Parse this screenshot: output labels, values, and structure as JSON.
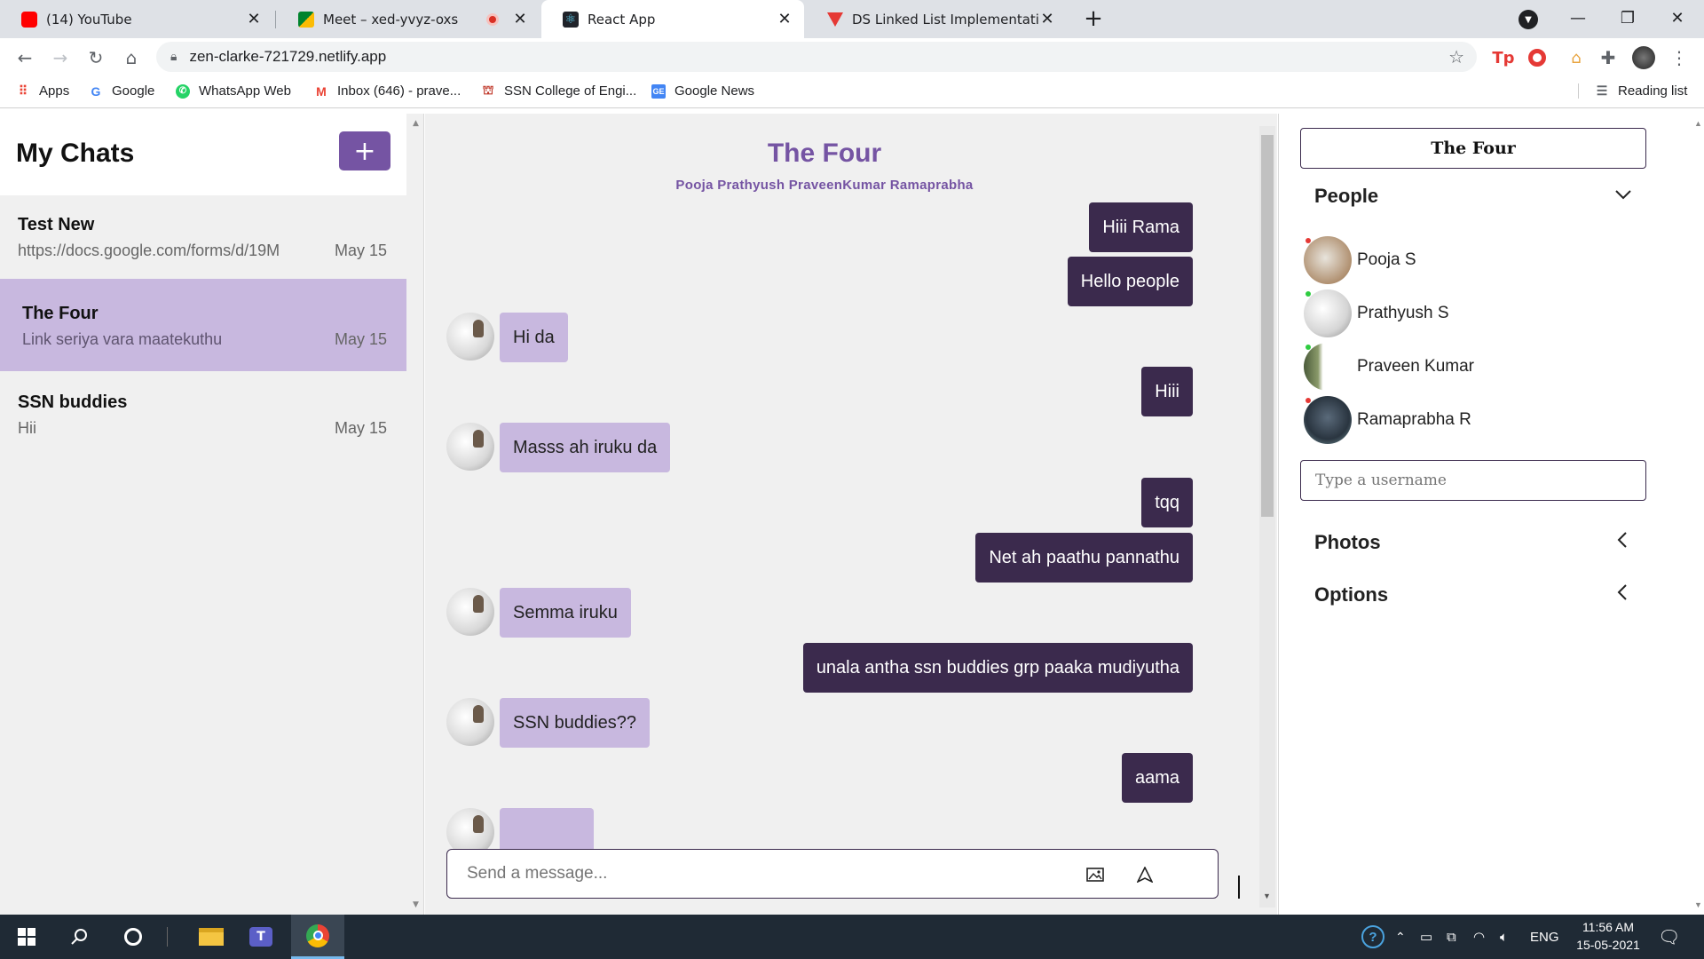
{
  "browser": {
    "tabs": [
      {
        "title": "(14) YouTube",
        "icon": "youtube-icon",
        "color": "#ff0000"
      },
      {
        "title": "Meet – xed-yvyz-oxs",
        "icon": "google-meet-icon",
        "color": "#00832d"
      },
      {
        "title": "React App",
        "icon": "react-icon",
        "color": "#61dafb"
      },
      {
        "title": "DS Linked List Implementation of",
        "icon": "vercel-icon",
        "color": "#e53935"
      }
    ],
    "url": "zen-clarke-721729.netlify.app",
    "bookmarks": [
      {
        "label": "Apps",
        "icon": "apps-grid-icon"
      },
      {
        "label": "Google",
        "icon": "google-icon"
      },
      {
        "label": "WhatsApp Web",
        "icon": "whatsapp-icon"
      },
      {
        "label": "Inbox (646) - prave...",
        "icon": "gmail-icon"
      },
      {
        "label": "SSN College of Engi...",
        "icon": "ssn-icon"
      },
      {
        "label": "Google News",
        "icon": "google-news-icon"
      }
    ],
    "reading_list": "Reading list"
  },
  "chat_list": {
    "title": "My Chats",
    "new_button": "+",
    "chats": [
      {
        "title": "Test New",
        "preview": "https://docs.google.com/forms/d/19M",
        "date": "May 15",
        "selected": false
      },
      {
        "title": "The Four",
        "preview": "Link seriya vara maatekuthu",
        "date": "May 15",
        "selected": true
      },
      {
        "title": "SSN buddies",
        "preview": "Hii",
        "date": "May 15",
        "selected": false
      }
    ]
  },
  "chat_feed": {
    "title": "The Four",
    "members": "Pooja Prathyush PraveenKumar Ramaprabha",
    "messages": [
      {
        "text": "Hiii Rama",
        "mine": true
      },
      {
        "text": "Hello people",
        "mine": true
      },
      {
        "text": "Hi da",
        "mine": false
      },
      {
        "text": "Hiii",
        "mine": true
      },
      {
        "text": "Masss ah iruku da",
        "mine": false
      },
      {
        "text": "tqq",
        "mine": true
      },
      {
        "text": "Net ah paathu pannathu",
        "mine": true
      },
      {
        "text": "Semma iruku",
        "mine": false
      },
      {
        "text": "unala antha ssn buddies grp paaka mudiyutha",
        "mine": true
      },
      {
        "text": "SSN buddies??",
        "mine": false
      },
      {
        "text": "aama",
        "mine": true
      }
    ],
    "input_placeholder": "Send a message..."
  },
  "settings": {
    "title": "The Four",
    "people_label": "People",
    "people": [
      {
        "name": "Pooja S",
        "online": false
      },
      {
        "name": "Prathyush S",
        "online": true
      },
      {
        "name": "Praveen Kumar",
        "online": true
      },
      {
        "name": "Ramaprabha R",
        "online": false
      }
    ],
    "username_placeholder": "Type a username",
    "photos_label": "Photos",
    "options_label": "Options"
  },
  "taskbar": {
    "language": "ENG",
    "time": "11:56 AM",
    "date": "15-05-2021"
  },
  "colors": {
    "accent": "#7554a3",
    "mine_bubble": "#3b2a4d",
    "theirs_bubble": "#c8b8df",
    "online": "#2ecc40",
    "offline": "#e53935"
  }
}
